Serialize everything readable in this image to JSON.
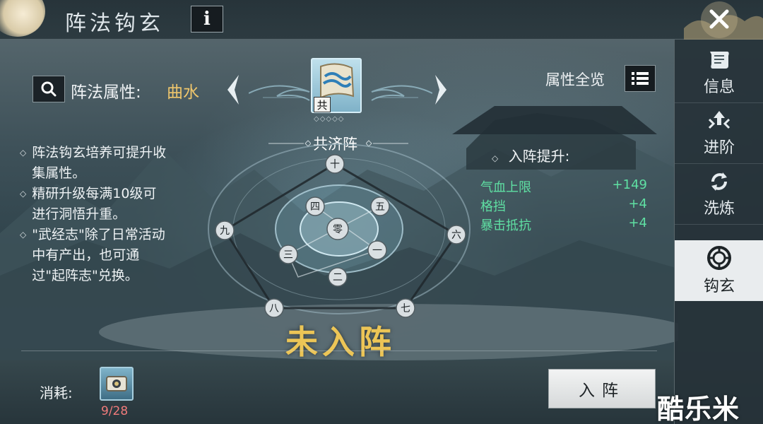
{
  "header": {
    "title": "阵法钩玄",
    "info_label": "i"
  },
  "sidebar": {
    "items": [
      {
        "label": "信息",
        "icon": "scroll-icon",
        "active": false
      },
      {
        "label": "进阶",
        "icon": "upgrade-arrows-icon",
        "active": false
      },
      {
        "label": "洗炼",
        "icon": "refresh-icon",
        "active": false
      },
      {
        "label": "钩玄",
        "icon": "formation-swirl-icon",
        "active": true
      }
    ]
  },
  "attribute": {
    "label": "阵法属性:",
    "value": "曲水"
  },
  "formation": {
    "name": "共济阵",
    "badge": "共",
    "stars": "◇◇◇◇◇"
  },
  "overview": {
    "label": "属性全览"
  },
  "description": [
    "阵法钩玄培养可提升收集属性。",
    "精研升级每满10级可进行洞悟升重。",
    "\"武经志\"除了日常活动中有产出，也可通过\"起阵志\"兑换。"
  ],
  "bonus": {
    "title": "入阵提升:",
    "stats": [
      {
        "name": "气血上限",
        "value": "+149"
      },
      {
        "name": "格挡",
        "value": "+4"
      },
      {
        "name": "暴击抵抗",
        "value": "+4"
      }
    ]
  },
  "circle_nodes": [
    {
      "label": "十"
    },
    {
      "label": "九"
    },
    {
      "label": "六"
    },
    {
      "label": "八"
    },
    {
      "label": "七"
    },
    {
      "label": "四"
    },
    {
      "label": "五"
    },
    {
      "label": "三"
    },
    {
      "label": "一"
    },
    {
      "label": "二"
    },
    {
      "label": "零"
    }
  ],
  "status": "未入阵",
  "cost": {
    "label": "消耗:",
    "count": "9/28"
  },
  "join_button": "入阵",
  "watermark": "酷乐米",
  "colors": {
    "accent_gold": "#efc66c",
    "stat_green": "#5fe0a3",
    "cost_red": "#f07b7b",
    "status_gold": "#ecc556"
  }
}
